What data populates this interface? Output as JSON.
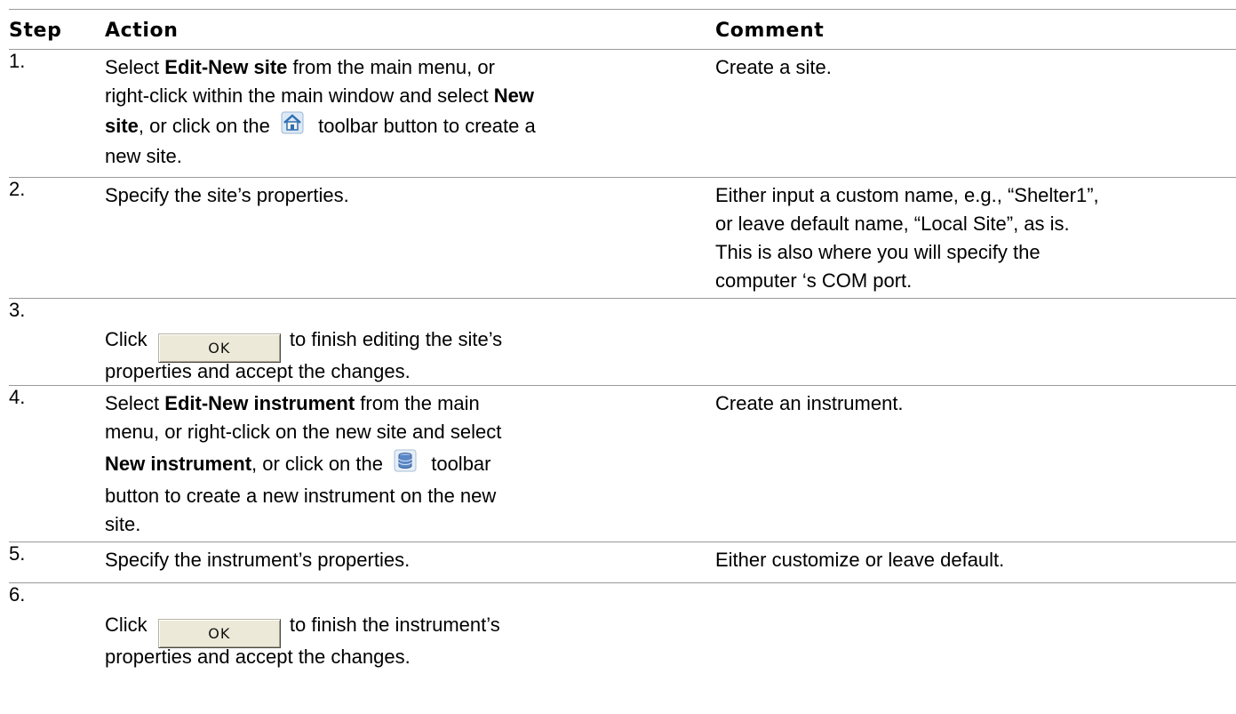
{
  "header": {
    "step": "Step",
    "action": "Action",
    "comment": "Comment"
  },
  "rows": [
    {
      "num": "1.",
      "a1": "Select ",
      "a1b": "Edit-New site",
      "a1c": " from the main menu, or",
      "a2": "right-click within the main window and select ",
      "a2b": "New",
      "a3b": "site",
      "a3": ", or click on the ",
      "a3c": " toolbar button to create a",
      "a4": "new site.",
      "comment": "Create a site.",
      "icon": "new-site-house-icon"
    },
    {
      "num": "2.",
      "action": "Specify the site’s properties.",
      "c1": "Either input a custom name, e.g., “Shelter1”,",
      "c2": "or leave default name, “Local Site”, as is.",
      "c3": "This is also where you will specify the",
      "c4": "computer ‘s COM port."
    },
    {
      "num": "3.",
      "a1": "Click ",
      "button": "OK",
      "a1c": " to finish editing the site’s",
      "a2": "properties and accept the changes."
    },
    {
      "num": "4.",
      "a1": "Select ",
      "a1b": "Edit-New instrument",
      "a1c": " from the main",
      "a2": "menu, or right-click on the new site and select",
      "a3b": "New instrument",
      "a3": ", or click on the ",
      "a3c": " toolbar",
      "a4": "button to create a new instrument on the new",
      "a5": "site.",
      "comment": "Create an instrument.",
      "icon": "new-instrument-database-icon"
    },
    {
      "num": "5.",
      "action": "Specify the instrument’s properties.",
      "comment": "Either customize or leave default."
    },
    {
      "num": "6.",
      "a1": "Click ",
      "button": "OK",
      "a1c": " to finish the instrument’s",
      "a2": "properties and accept the changes."
    }
  ]
}
